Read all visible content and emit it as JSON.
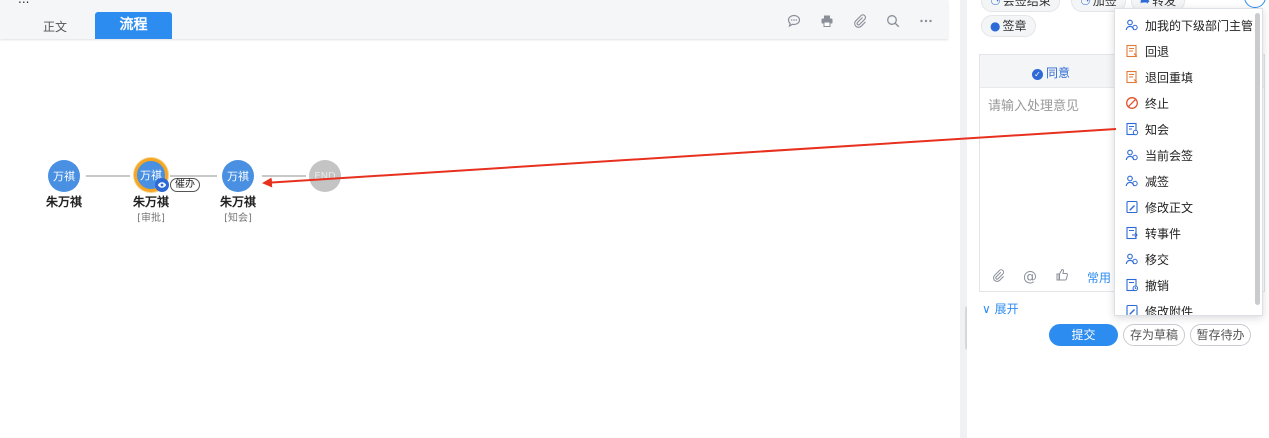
{
  "header": {
    "crumb": "...",
    "tabs": [
      {
        "label": "正文"
      },
      {
        "label": "流程"
      }
    ]
  },
  "flow": {
    "nodes": [
      {
        "avatar": "万祺",
        "name": "朱万祺",
        "role": ""
      },
      {
        "avatar": "万祺",
        "name": "朱万祺",
        "role": "[审批]",
        "badge": "催办"
      },
      {
        "avatar": "万祺",
        "name": "朱万祺",
        "role": "[知会]"
      },
      {
        "avatar": "END",
        "name": "",
        "role": ""
      }
    ]
  },
  "panel": {
    "top_buttons": [
      "会签结束",
      "加签",
      "转发"
    ],
    "seal_label": "签章",
    "agree_label": "同意",
    "opinion_placeholder": "请输入处理意见",
    "common_label": "常用",
    "expand_label": "展开",
    "submit_label": "提交",
    "draft_label": "存为草稿",
    "later_label": "暂存待办"
  },
  "menu": {
    "items": [
      {
        "label": "加我的下级部门主管",
        "icon": "users-icon"
      },
      {
        "label": "回退",
        "icon": "doc-back-icon"
      },
      {
        "label": "退回重填",
        "icon": "doc-return-icon"
      },
      {
        "label": "终止",
        "icon": "stop-icon"
      },
      {
        "label": "知会",
        "icon": "doc-notify-icon"
      },
      {
        "label": "当前会签",
        "icon": "users-icon"
      },
      {
        "label": "减签",
        "icon": "users-icon"
      },
      {
        "label": "修改正文",
        "icon": "edit-doc-icon"
      },
      {
        "label": "转事件",
        "icon": "doc-transfer-icon"
      },
      {
        "label": "移交",
        "icon": "users-icon"
      },
      {
        "label": "撤销",
        "icon": "doc-revoke-icon"
      },
      {
        "label": "修改附件",
        "icon": "edit-doc-icon"
      }
    ]
  },
  "colors": {
    "accent": "#2d8cf0",
    "node": "#4a90e2",
    "arrow": "#e8301e",
    "active_ring": "#f5a623"
  }
}
